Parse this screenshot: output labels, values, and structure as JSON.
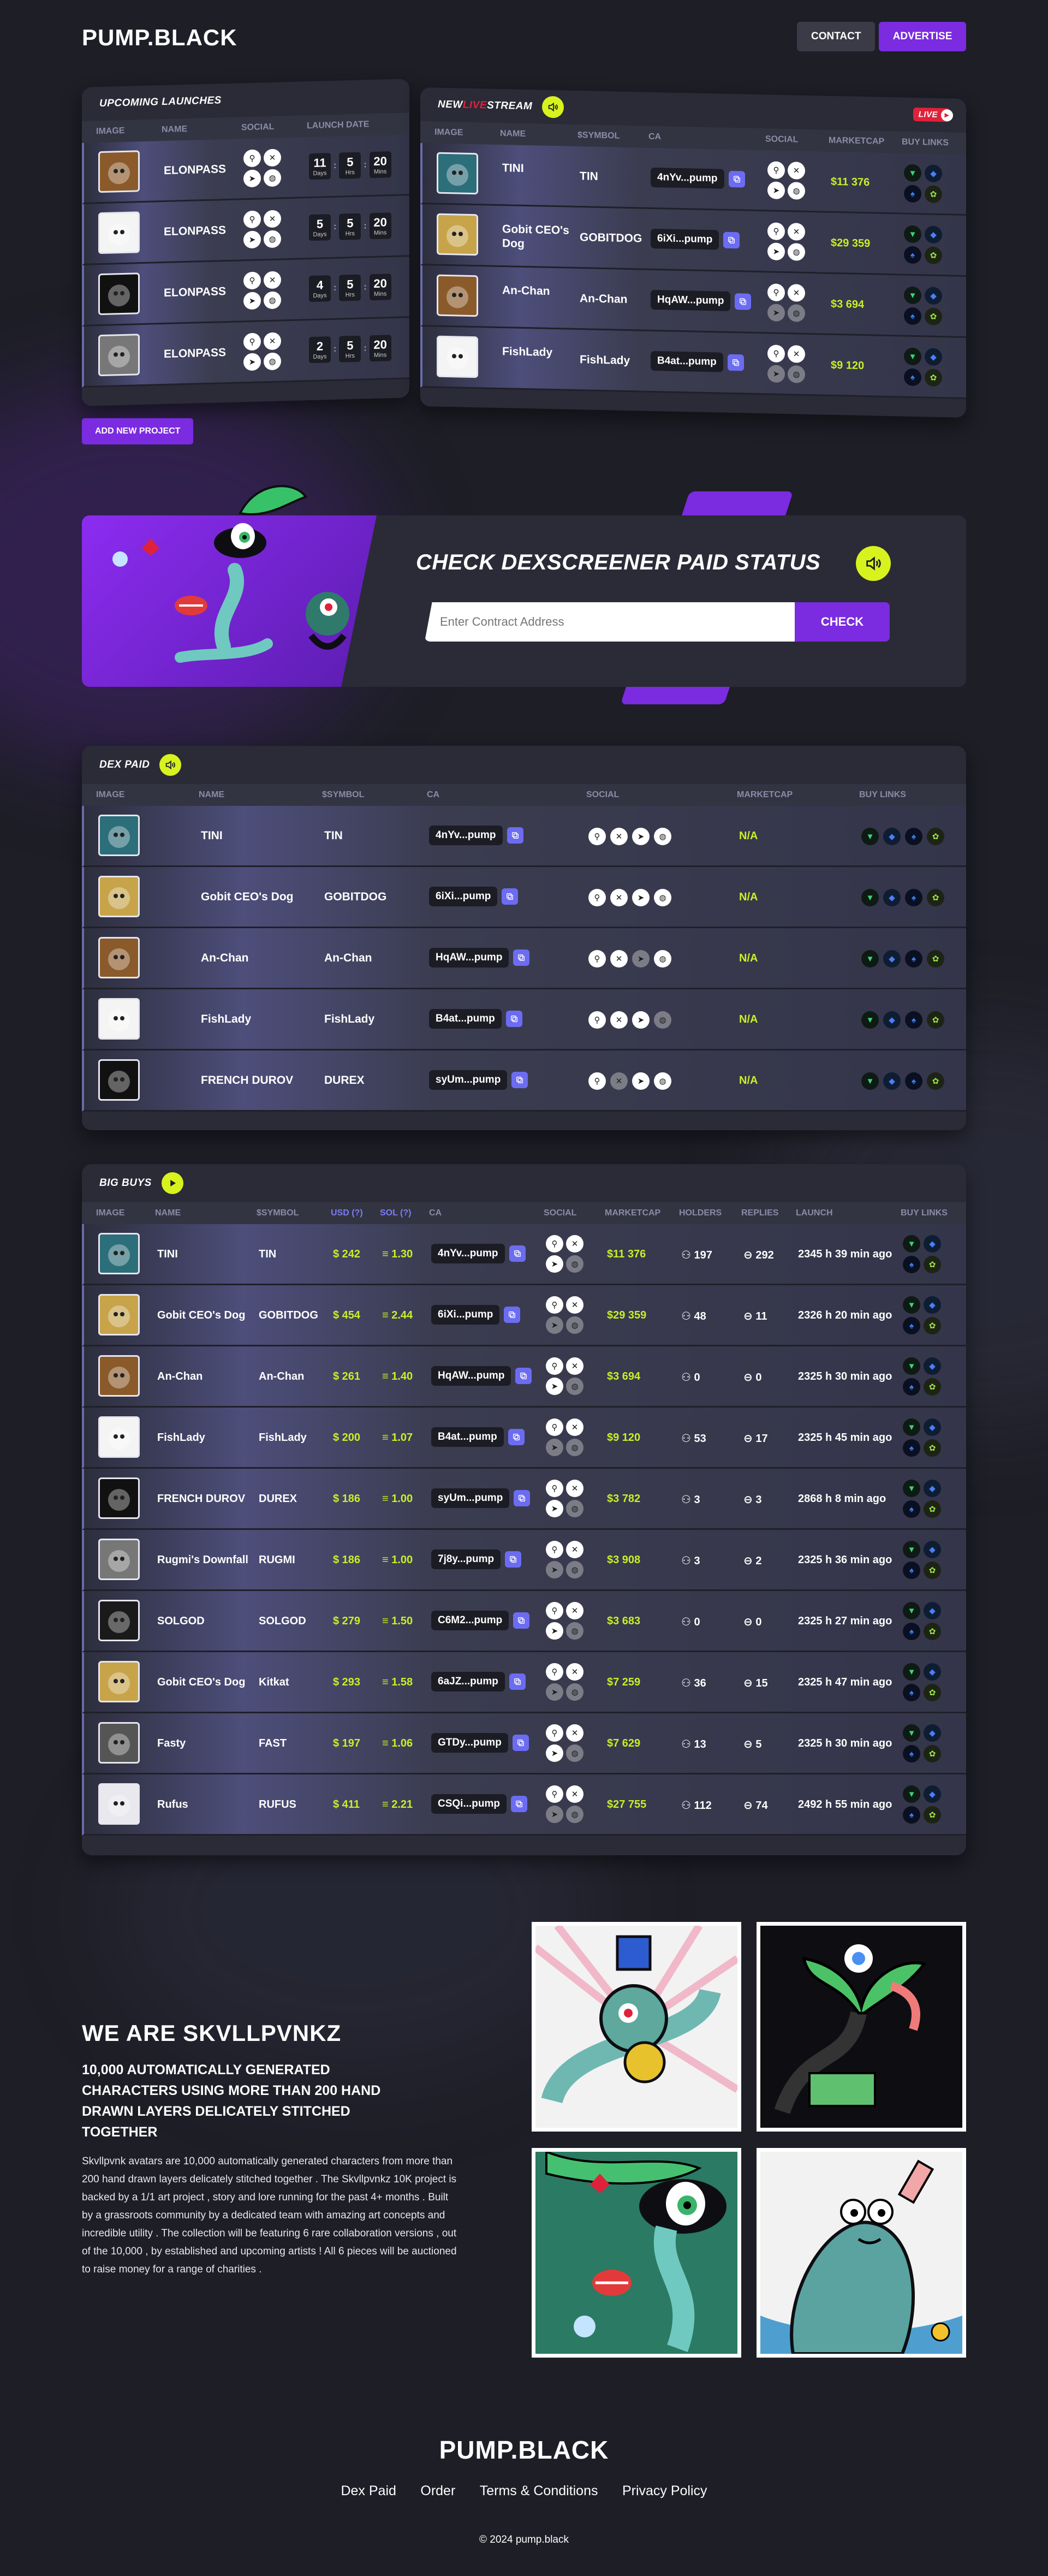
{
  "header": {
    "logo": "PUMP.BLACK",
    "contact": "CONTACT",
    "advertise": "ADVERTISE"
  },
  "upcoming": {
    "title": "UPCOMING LAUNCHES",
    "columns": [
      "IMAGE",
      "NAME",
      "SOCIAL",
      "LAUNCH DATE"
    ],
    "units": {
      "days": "Days",
      "hrs": "Hrs",
      "mins": "Mins"
    },
    "rows": [
      {
        "name": "ELONPASS",
        "days": "11",
        "hrs": "5",
        "mins": "20"
      },
      {
        "name": "ELONPASS",
        "days": "5",
        "hrs": "5",
        "mins": "20"
      },
      {
        "name": "ELONPASS",
        "days": "4",
        "hrs": "5",
        "mins": "20"
      },
      {
        "name": "ELONPASS",
        "days": "2",
        "hrs": "5",
        "mins": "20"
      }
    ]
  },
  "livestream": {
    "title_a": "NEW ",
    "title_b": "LIVE",
    "title_c": "STREAM",
    "live_badge": "LIVE",
    "columns": [
      "IMAGE",
      "NAME",
      "$SYMBOL",
      "CA",
      "SOCIAL",
      "MARKETCAP",
      "BUY LINKS"
    ],
    "rows": [
      {
        "name": "TINI",
        "symbol": "TIN",
        "ca": "4nYv...pump",
        "mc": "$11 376"
      },
      {
        "name": "Gobit CEO's Dog",
        "symbol": "GOBITDOG",
        "ca": "6iXi...pump",
        "mc": "$29 359"
      },
      {
        "name": "An-Chan",
        "symbol": "An-Chan",
        "ca": "HqAW...pump",
        "mc": "$3 694"
      },
      {
        "name": "FishLady",
        "symbol": "FishLady",
        "ca": "B4at...pump",
        "mc": "$9 120"
      }
    ]
  },
  "add_project": "ADD NEW PROJECT",
  "dexscreener": {
    "title": "CHECK DEXSCREENER PAID STATUS",
    "placeholder": "Enter Contract Address",
    "button": "CHECK"
  },
  "dexpaid": {
    "title": "DEX PAID",
    "columns": [
      "IMAGE",
      "NAME",
      "$SYMBOL",
      "CA",
      "SOCIAL",
      "MARKETCAP",
      "BUY LINKS"
    ],
    "rows": [
      {
        "name": "TINI",
        "symbol": "TIN",
        "ca": "4nYv...pump",
        "mc": "N/A"
      },
      {
        "name": "Gobit CEO's Dog",
        "symbol": "GOBITDOG",
        "ca": "6iXi...pump",
        "mc": "N/A"
      },
      {
        "name": "An-Chan",
        "symbol": "An-Chan",
        "ca": "HqAW...pump",
        "mc": "N/A"
      },
      {
        "name": "FishLady",
        "symbol": "FishLady",
        "ca": "B4at...pump",
        "mc": "N/A"
      },
      {
        "name": "FRENCH DUROV",
        "symbol": "DUREX",
        "ca": "syUm...pump",
        "mc": "N/A"
      }
    ]
  },
  "bigbuys": {
    "title": "BIG BUYS",
    "columns": [
      "IMAGE",
      "NAME",
      "$SYMBOL",
      "USD (?)",
      "SOL (?)",
      "CA",
      "SOCIAL",
      "MARKETCAP",
      "HOLDERS",
      "REPLIES",
      "LAUNCH",
      "BUY LINKS"
    ],
    "rows": [
      {
        "name": "TINI",
        "symbol": "TIN",
        "usd": "$ 242",
        "sol": "≡ 1.30",
        "ca": "4nYv...pump",
        "mc": "$11 376",
        "holders": "197",
        "replies": "292",
        "launch": "2345 h 39 min ago"
      },
      {
        "name": "Gobit CEO's Dog",
        "symbol": "GOBITDOG",
        "usd": "$ 454",
        "sol": "≡ 2.44",
        "ca": "6iXi...pump",
        "mc": "$29 359",
        "holders": "48",
        "replies": "11",
        "launch": "2326 h 20 min ago"
      },
      {
        "name": "An-Chan",
        "symbol": "An-Chan",
        "usd": "$ 261",
        "sol": "≡ 1.40",
        "ca": "HqAW...pump",
        "mc": "$3 694",
        "holders": "0",
        "replies": "0",
        "launch": "2325 h 30 min ago"
      },
      {
        "name": "FishLady",
        "symbol": "FishLady",
        "usd": "$ 200",
        "sol": "≡ 1.07",
        "ca": "B4at...pump",
        "mc": "$9 120",
        "holders": "53",
        "replies": "17",
        "launch": "2325 h 45 min ago"
      },
      {
        "name": "FRENCH DUROV",
        "symbol": "DUREX",
        "usd": "$ 186",
        "sol": "≡ 1.00",
        "ca": "syUm...pump",
        "mc": "$3 782",
        "holders": "3",
        "replies": "3",
        "launch": "2868 h 8 min ago"
      },
      {
        "name": "Rugmi's Downfall",
        "symbol": "RUGMI",
        "usd": "$ 186",
        "sol": "≡ 1.00",
        "ca": "7j8y...pump",
        "mc": "$3 908",
        "holders": "3",
        "replies": "2",
        "launch": "2325 h 36 min ago"
      },
      {
        "name": "SOLGOD",
        "symbol": "SOLGOD",
        "usd": "$ 279",
        "sol": "≡ 1.50",
        "ca": "C6M2...pump",
        "mc": "$3 683",
        "holders": "0",
        "replies": "0",
        "launch": "2325 h 27 min ago"
      },
      {
        "name": "Gobit CEO's Dog",
        "symbol": "Kitkat",
        "usd": "$ 293",
        "sol": "≡ 1.58",
        "ca": "6aJZ...pump",
        "mc": "$7 259",
        "holders": "36",
        "replies": "15",
        "launch": "2325 h 47 min ago"
      },
      {
        "name": "Fasty",
        "symbol": "FAST",
        "usd": "$ 197",
        "sol": "≡ 1.06",
        "ca": "GTDy...pump",
        "mc": "$7 629",
        "holders": "13",
        "replies": "5",
        "launch": "2325 h 30 min ago"
      },
      {
        "name": "Rufus",
        "symbol": "RUFUS",
        "usd": "$ 411",
        "sol": "≡ 2.21",
        "ca": "CSQi...pump",
        "mc": "$27 755",
        "holders": "112",
        "replies": "74",
        "launch": "2492 h 55 min ago"
      }
    ]
  },
  "about": {
    "title": "WE ARE SKVLLPVNKZ",
    "subtitle": "10,000 AUTOMATICALLY GENERATED CHARACTERS USING MORE THAN 200 HAND DRAWN LAYERS DELICATELY STITCHED TOGETHER",
    "body": "Skvllpvnk avatars are 10,000 automatically generated characters from more than 200 hand drawn layers delicately stitched together . The Skvllpvnkz 10K project is backed by a 1/1 art project , story and lore running for the past 4+ months . Built by a grassroots community by a dedicated team with amazing art concepts and incredible utility . The collection will be featuring 6 rare collaboration versions , out of the 10,000 , by established and upcoming artists ! All 6 pieces will be auctioned to raise money for a range of charities ."
  },
  "footer": {
    "logo": "PUMP.BLACK",
    "links": [
      "Dex Paid",
      "Order",
      "Terms & Conditions",
      "Privacy Policy"
    ],
    "copyright": "© 2024 pump.black"
  },
  "colors": {
    "accent_purple": "#7b2be0",
    "accent_lime": "#d8f21e",
    "marketcap": "#c9ef26",
    "live_red": "#e0213a",
    "background": "#1d1e26"
  }
}
